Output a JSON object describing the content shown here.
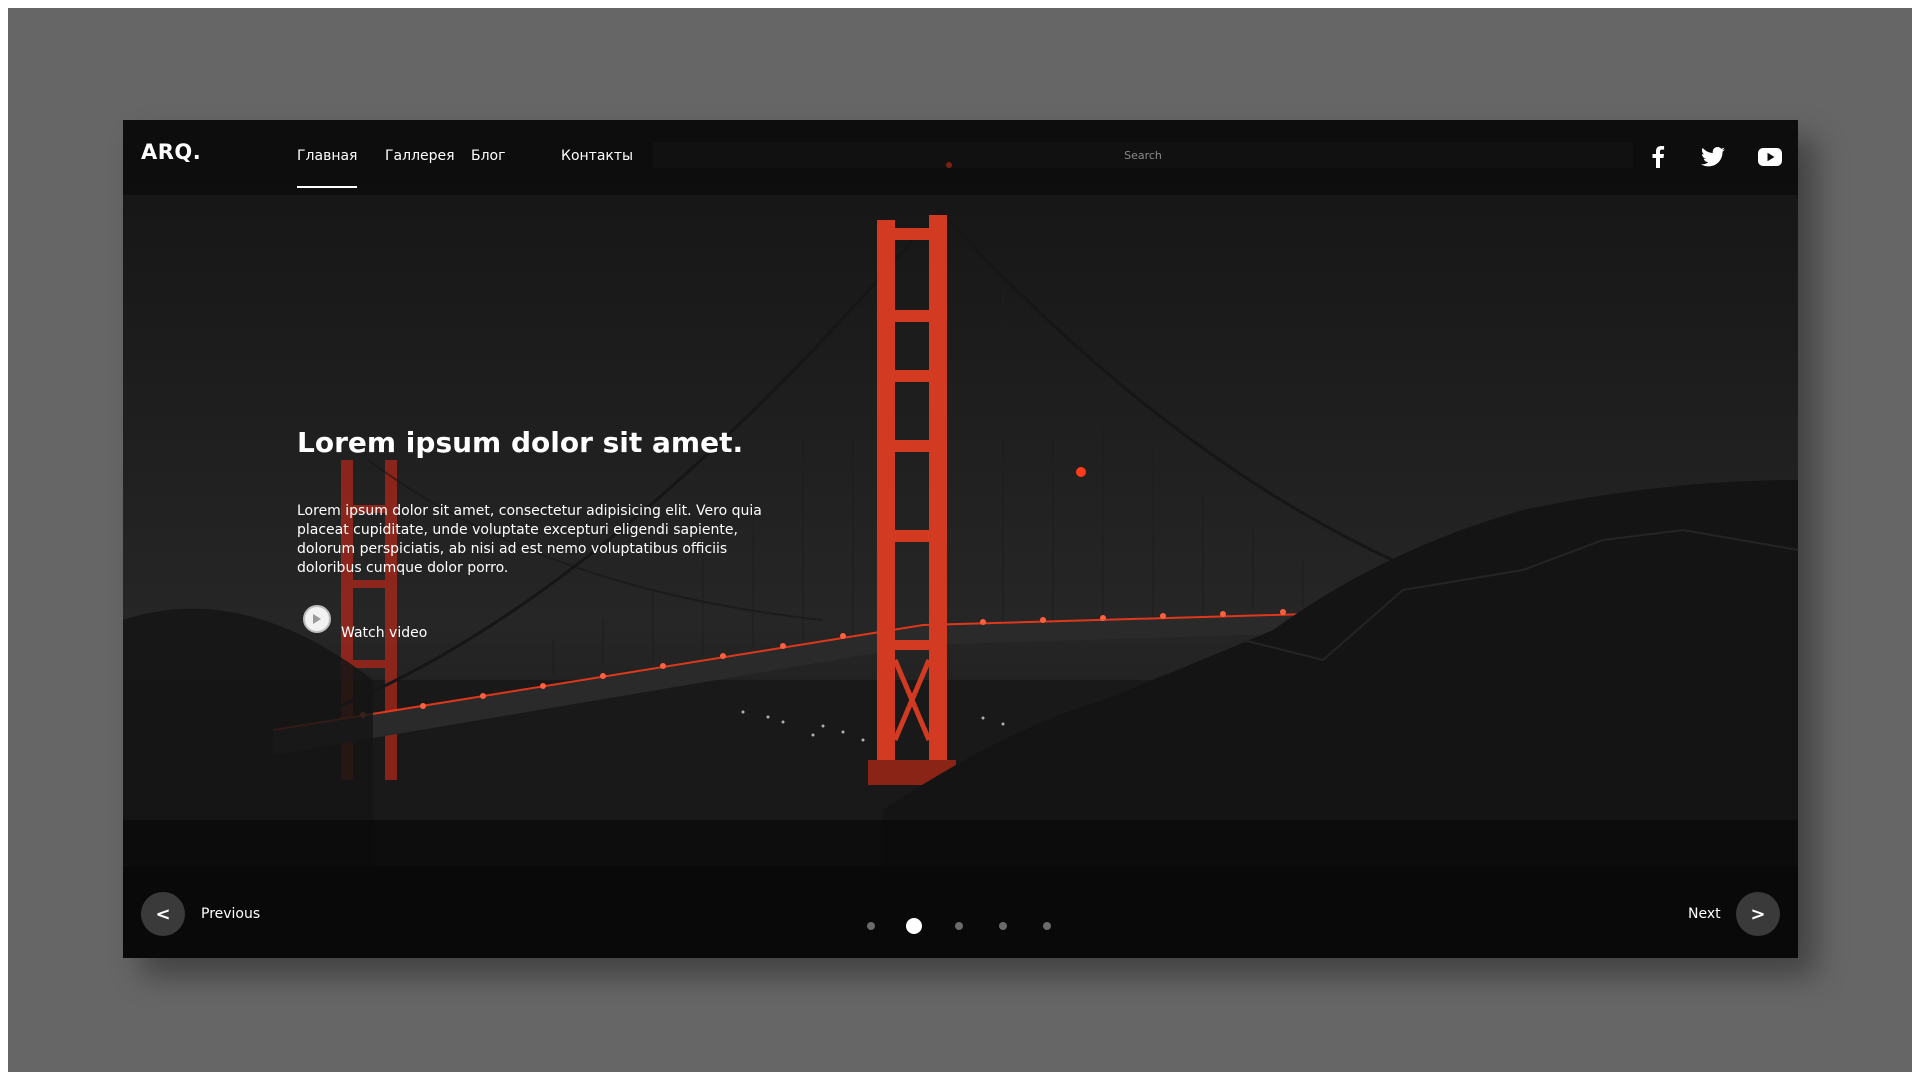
{
  "header": {
    "logo": "ARQ.",
    "nav": [
      {
        "label": "Главная",
        "active": true
      },
      {
        "label": "Галлерея",
        "active": false
      },
      {
        "label": "Блог",
        "active": false
      },
      {
        "label": "Контакты",
        "active": false
      }
    ],
    "search_placeholder": "Search",
    "social": [
      "facebook-icon",
      "twitter-icon",
      "youtube-icon"
    ]
  },
  "hero": {
    "title": "Lorem ipsum dolor sit amet.",
    "text": "Lorem ipsum dolor sit amet, consectetur adipisicing elit. Vero quia placeat cupiditate, unde voluptate excepturi eligendi sapiente, dolorum perspiciatis, ab nisi ad est nemo voluptatibus officiis doloribus cumque dolor porro.",
    "watch_label": "Watch video"
  },
  "slider": {
    "prev_symbol": "<",
    "prev_label": "Previous",
    "next_label": "Next",
    "next_symbol": ">",
    "dot_count": 5,
    "active_dot": 2
  },
  "colors": {
    "accent": "#ff3b1a",
    "background": "#0b0b0b",
    "outer": "#666666"
  }
}
